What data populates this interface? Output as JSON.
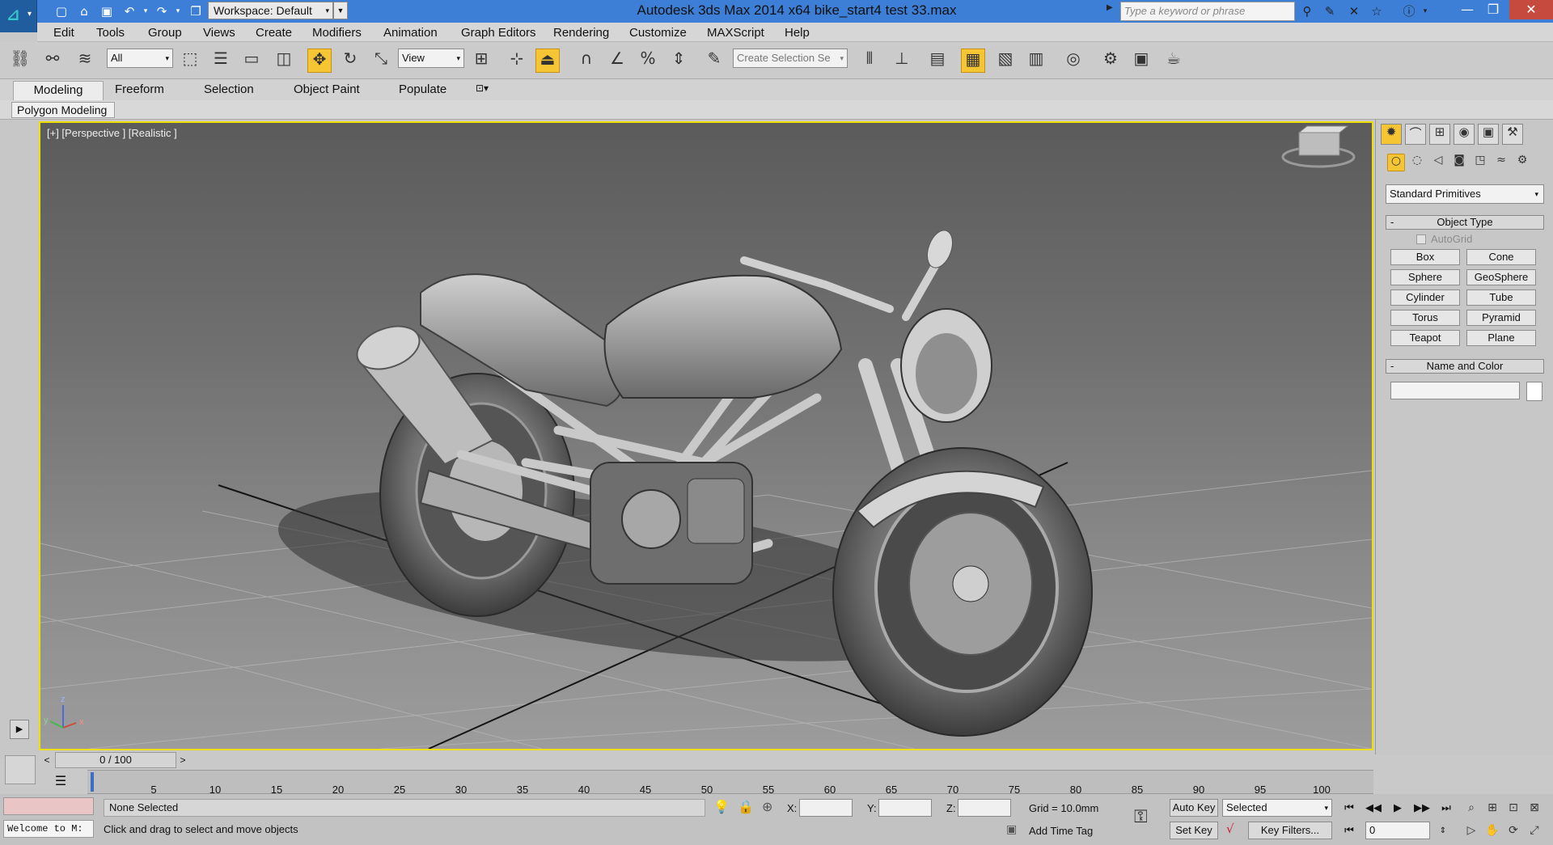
{
  "titlebar": {
    "workspace_label": "Workspace: Default",
    "app_title": "Autodesk 3ds Max  2014 x64      bike_start4 test 33.max",
    "search_placeholder": "Type a keyword or phrase"
  },
  "menu": [
    "Edit",
    "Tools",
    "Group",
    "Views",
    "Create",
    "Modifiers",
    "Animation",
    "Graph Editors",
    "Rendering",
    "Customize",
    "MAXScript",
    "Help"
  ],
  "toolbar": {
    "filter_value": "All",
    "coord_system_value": "View",
    "selection_set_placeholder": "Create Selection Se"
  },
  "ribbon": {
    "tabs": [
      "Modeling",
      "Freeform",
      "Selection",
      "Object Paint",
      "Populate"
    ],
    "panel_label": "Polygon Modeling"
  },
  "viewport": {
    "label": "[+] [Perspective ] [Realistic ]",
    "axis_x": "x",
    "axis_y": "y",
    "axis_z": "z"
  },
  "command_panel": {
    "category_value": "Standard Primitives",
    "object_type_title": "Object Type",
    "autogrid_label": "AutoGrid",
    "primitives": [
      "Box",
      "Cone",
      "Sphere",
      "GeoSphere",
      "Cylinder",
      "Tube",
      "Torus",
      "Pyramid",
      "Teapot",
      "Plane"
    ],
    "name_color_title": "Name and Color"
  },
  "timeline": {
    "slider_label": "0 / 100",
    "ticks": [
      "5",
      "10",
      "15",
      "20",
      "25",
      "30",
      "35",
      "40",
      "45",
      "50",
      "55",
      "60",
      "65",
      "70",
      "75",
      "80",
      "85",
      "90",
      "95",
      "100"
    ]
  },
  "status": {
    "welcome": "Welcome to M:",
    "selection_text": "None Selected",
    "prompt_text": "Click and drag to select and move objects",
    "x_label": "X:",
    "y_label": "Y:",
    "z_label": "Z:",
    "grid_text": "Grid = 10.0mm",
    "add_time_tag": "Add Time Tag",
    "auto_key": "Auto Key",
    "set_key": "Set Key",
    "selected_value": "Selected",
    "key_filters": "Key Filters...",
    "frame_value": "0"
  },
  "colors": {
    "titlebar": "#3d7fd6",
    "active_viewport_border": "#f0e000",
    "active_tool": "#f5c534"
  }
}
